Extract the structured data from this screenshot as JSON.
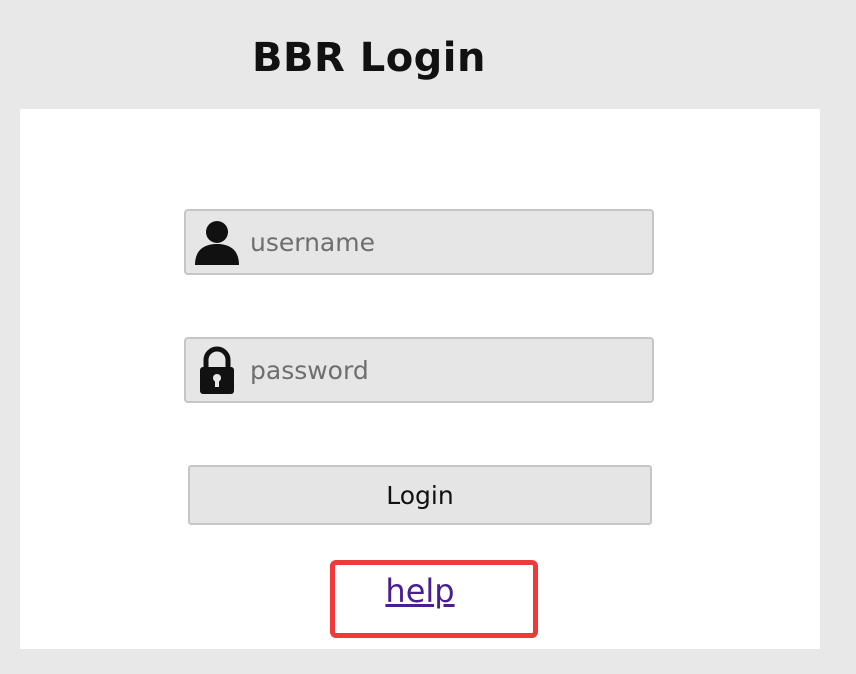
{
  "header": {
    "title": "BBR Login"
  },
  "form": {
    "username": {
      "icon": "user-icon",
      "placeholder": "username",
      "value": ""
    },
    "password": {
      "icon": "lock-icon",
      "placeholder": "password",
      "value": ""
    },
    "login_label": "Login",
    "help_label": "help"
  },
  "colors": {
    "page_background": "#e8e8e8",
    "panel_background": "#ffffff",
    "field_background": "#e6e6e6",
    "highlight_border": "#ee3a3a",
    "link": "#4b1e8f"
  }
}
